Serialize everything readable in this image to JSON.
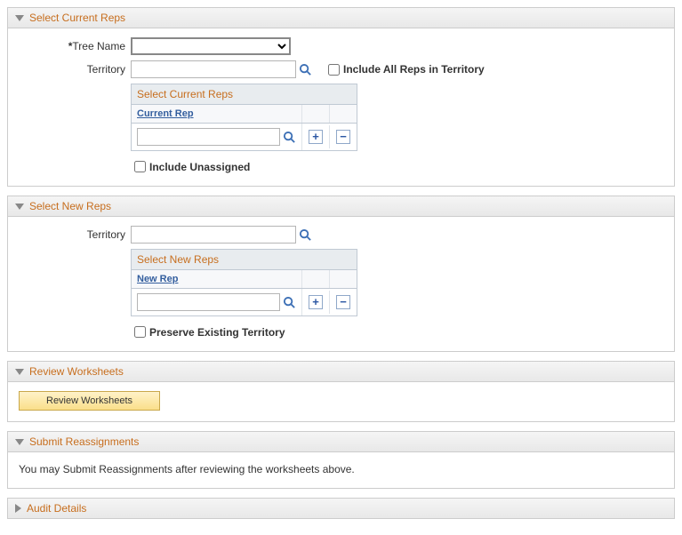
{
  "sections": {
    "select_current_reps": {
      "title": "Select Current Reps",
      "tree_name_label": "Tree Name",
      "territory_label": "Territory",
      "territory_value": "",
      "include_all_label": "Include All Reps in Territory",
      "grid_title": "Select Current Reps",
      "grid_col_header": "Current Rep",
      "grid_row_value": "",
      "include_unassigned_label": "Include Unassigned"
    },
    "select_new_reps": {
      "title": "Select New Reps",
      "territory_label": "Territory",
      "territory_value": "",
      "grid_title": "Select New Reps",
      "grid_col_header": "New Rep",
      "grid_row_value": "",
      "preserve_label": "Preserve Existing Territory"
    },
    "review_worksheets": {
      "title": "Review Worksheets",
      "button_label": "Review Worksheets"
    },
    "submit": {
      "title": "Submit Reassignments",
      "info": "You may Submit Reassignments after reviewing the worksheets above."
    },
    "audit": {
      "title": "Audit Details"
    }
  }
}
